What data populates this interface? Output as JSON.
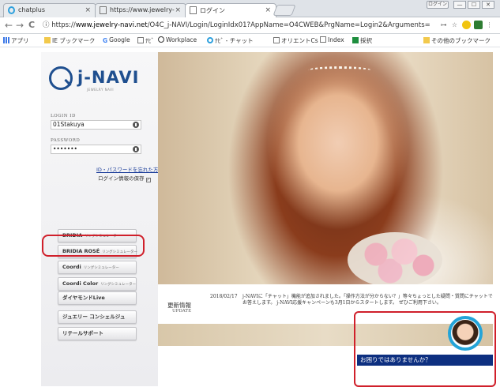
{
  "browser": {
    "tabs": [
      {
        "title": "chatplus",
        "close": "×",
        "active": false
      },
      {
        "title": "https://www.jewelry-",
        "close": "×",
        "active": false
      },
      {
        "title": "ログイン",
        "close": "×",
        "active": true
      }
    ],
    "user_chip": "ログイン",
    "window_controls": [
      "—",
      "☐",
      "✕"
    ],
    "address": {
      "scheme_icon": "ⓘ",
      "prefix": "https://",
      "host": "www.jewelry-navi.net",
      "path": "/O4C_j-NAVI/Login/LoginIdx01?AppName=O4CWEB&PrgName=Login2&Arguments="
    },
    "nav": {
      "back": "←",
      "forward": "→",
      "reload": "C"
    },
    "bookmarks": [
      {
        "label": "アプリ"
      },
      {
        "label": "IE ブックマーク"
      },
      {
        "label": "Google"
      },
      {
        "label": "ﾅﾋﾞ"
      },
      {
        "label": "Workplace"
      },
      {
        "label": "ﾅﾋﾞ - チャット"
      },
      {
        "label": "オリエントCs"
      },
      {
        "label": "Index"
      },
      {
        "label": "採択"
      },
      {
        "label": "その他のブックマーク"
      }
    ],
    "colors": {
      "accent_red": "#d0202b",
      "chat_blue": "#0d2f80",
      "logo_blue": "#1f4f8f"
    }
  },
  "login": {
    "logo_text": "j-NAVI",
    "logo_sub": "JEWELRY NAVI",
    "id_label": "LOGIN ID",
    "id_value": "01Stakuya",
    "password_label": "PASSWORD",
    "password_value": "•••••••",
    "forgot_link": "ID・パスワードを忘れた方",
    "save_login": "ログイン情報の保存",
    "save_checked": "✓"
  },
  "menu": [
    {
      "label": "BRIDIA",
      "sub": "リングシミュレーター"
    },
    {
      "label": "BRIDIA ROSÉ",
      "sub": "リングシミュレーター"
    },
    {
      "label": "Coordi",
      "sub": "リングシミュレーター"
    },
    {
      "label": "Coordi Color",
      "sub": "リングシミュレーター"
    },
    {
      "label": "ダイヤモンドLive",
      "sub": ""
    },
    {
      "label": "ジュエリー コンシェルジュ",
      "sub": ""
    },
    {
      "label": "リテールサポート",
      "sub": ""
    }
  ],
  "news": {
    "heading": "更新情報",
    "heading_sub": "UPDATE",
    "date": "2018/02/17",
    "text": "j-NAVIに「チャット」機能が追加されました。「操作方法が分からない？」等々ちょっとした疑問・質問にチャットでお答えします。 j-NAVI応援キャンペーンも3月1日からスタートします。 ぜひご利用下さい。"
  },
  "chat": {
    "prompt": "お困りではありませんか？"
  }
}
